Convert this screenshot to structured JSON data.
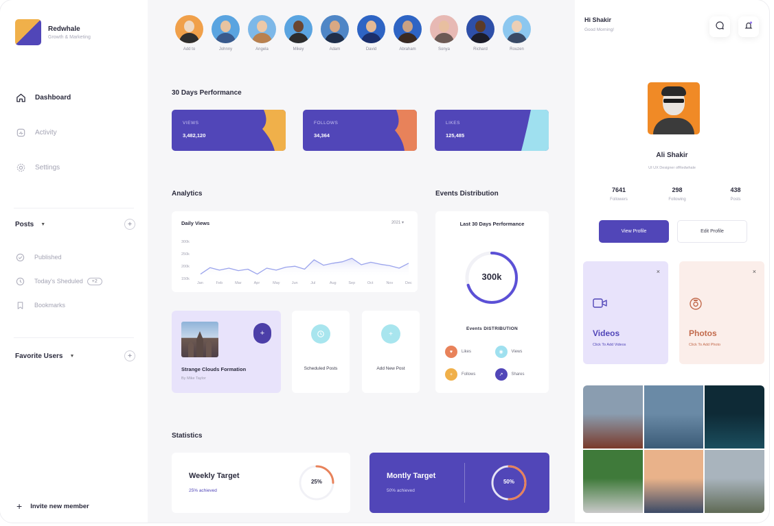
{
  "brand": {
    "name": "Redwhale",
    "subtitle": "Growth & Marketing"
  },
  "sidebar": {
    "nav": [
      {
        "label": "Dashboard",
        "icon": "home-icon",
        "active": true
      },
      {
        "label": "Activity",
        "icon": "activity-icon",
        "active": false
      },
      {
        "label": "Settings",
        "icon": "settings-icon",
        "active": false
      }
    ],
    "posts": {
      "title": "Posts",
      "items": [
        {
          "label": "Published",
          "icon": "check-circle-icon"
        },
        {
          "label": "Today's Sheduled",
          "icon": "clock-icon",
          "badge": "+2"
        },
        {
          "label": "Bookmarks",
          "icon": "bookmark-icon"
        }
      ]
    },
    "favorites": {
      "title": "Favorite Users"
    },
    "invite": "Invite new member"
  },
  "avatars": [
    {
      "name": "Add to",
      "bg": "#f0a04a",
      "skin": "#eed9c4",
      "shirt": "#2e2e2e"
    },
    {
      "name": "Johnny",
      "bg": "#5aa4e0",
      "skin": "#e8c3a0",
      "shirt": "#3a5a8c"
    },
    {
      "name": "Angela",
      "bg": "#7db8e8",
      "skin": "#edc9a8",
      "shirt": "#b9814f"
    },
    {
      "name": "Mikey",
      "bg": "#5aa4e0",
      "skin": "#6b4630",
      "shirt": "#2d2d2d"
    },
    {
      "name": "Adam",
      "bg": "#4f86c6",
      "skin": "#d9a883",
      "shirt": "#1f2f4a"
    },
    {
      "name": "David",
      "bg": "#2e64c4",
      "skin": "#e4b995",
      "shirt": "#1b2f6b"
    },
    {
      "name": "Abraham",
      "bg": "#2e64c4",
      "skin": "#caa183",
      "shirt": "#3a2a22"
    },
    {
      "name": "Sonya",
      "bg": "#e7b9b4",
      "skin": "#e8bfa0",
      "shirt": "#6c5a55"
    },
    {
      "name": "Richard",
      "bg": "#2e4fa8",
      "skin": "#5c3b28",
      "shirt": "#1c1c28"
    },
    {
      "name": "Rouzen",
      "bg": "#8cc7ef",
      "skin": "#edcfb5",
      "shirt": "#3a4a66"
    }
  ],
  "performance": {
    "title": "30 Days Performance",
    "cards": [
      {
        "label": "VIEWS",
        "value": "3,482,120",
        "accent": "#f0b04a"
      },
      {
        "label": "FOLLOWS",
        "value": "34,364",
        "accent": "#e8825a"
      },
      {
        "label": "LIKES",
        "value": "125,485",
        "accent": "#9fe0ef"
      }
    ]
  },
  "analytics": {
    "title": "Analytics",
    "chart_title": "Daily Views",
    "year": "2021"
  },
  "chart_data": {
    "type": "line",
    "title": "Daily Views",
    "categories": [
      "Jan",
      "Feb",
      "Mar",
      "Apr",
      "May",
      "Jun",
      "Jul",
      "Aug",
      "Sep",
      "Oct",
      "Nov",
      "Dec"
    ],
    "x_domain": [
      0,
      11
    ],
    "y_ticks": [
      "300k",
      "250k",
      "200k",
      "150k"
    ],
    "ylim": [
      150,
      300
    ],
    "series": [
      {
        "values": [
          [
            0,
            162
          ],
          [
            0.5,
            188
          ],
          [
            1,
            178
          ],
          [
            1.5,
            186
          ],
          [
            2,
            176
          ],
          [
            2.5,
            182
          ],
          [
            3,
            162
          ],
          [
            3.5,
            186
          ],
          [
            4,
            178
          ],
          [
            4.5,
            190
          ],
          [
            5,
            194
          ],
          [
            5.5,
            182
          ],
          [
            6,
            220
          ],
          [
            6.5,
            198
          ],
          [
            7,
            206
          ],
          [
            7.5,
            212
          ],
          [
            8,
            226
          ],
          [
            8.5,
            200
          ],
          [
            9,
            210
          ],
          [
            9.5,
            202
          ],
          [
            10,
            196
          ],
          [
            10.5,
            186
          ],
          [
            11,
            206
          ]
        ]
      }
    ],
    "grid": false,
    "color": "#9aa3ec"
  },
  "events": {
    "title": "Events Distribution",
    "card_title": "Last 30 Days Performance",
    "total": "300k",
    "ring_fraction": 0.7,
    "subtitle": "Events DISTRIBUTION",
    "legend": [
      {
        "label": "Likes",
        "color": "#e8825a"
      },
      {
        "label": "Views",
        "color": "#9fe0ef"
      },
      {
        "label": "Follows",
        "color": "#f0b04a"
      },
      {
        "label": "Shares",
        "color": "#5146b8"
      }
    ]
  },
  "post_card": {
    "title": "Strange Clouds Formation",
    "author": "By Mike Taylor"
  },
  "scheduled": {
    "label": "Scheduled Posts"
  },
  "add_post": {
    "label": "Add New Post"
  },
  "statistics": {
    "title": "Statistics",
    "weekly": {
      "title": "Weekly Target",
      "sub": "25% achieved",
      "value": "25%",
      "fraction": 0.25
    },
    "monthly": {
      "title": "Montly Target",
      "sub": "50% achieved",
      "value": "50%",
      "fraction": 0.5
    }
  },
  "profile": {
    "greeting": "Hi Shakir",
    "greeting_sub": "Good Morning!",
    "name": "Ali Shakir",
    "role": "UI UX Designer ofRedwhale",
    "stats": [
      {
        "value": "7641",
        "label": "Followers"
      },
      {
        "value": "298",
        "label": "Following"
      },
      {
        "value": "438",
        "label": "Posts"
      }
    ],
    "view_label": "View Profile",
    "edit_label": "Edit Profile"
  },
  "media": {
    "videos": {
      "title": "Videos",
      "sub": "Click To Add Videos"
    },
    "photos": {
      "title": "Photos",
      "sub": "Click To Add Photo"
    }
  },
  "gallery": [
    {
      "top": "#8a9db0",
      "bottom": "#7a3a2a"
    },
    {
      "top": "#6a8aa6",
      "bottom": "#3b5b77"
    },
    {
      "top": "#0e2a36",
      "bottom": "#1b4e5e"
    },
    {
      "top": "#3f7a3a",
      "bottom": "#c9c9c9"
    },
    {
      "top": "#e9b28a",
      "bottom": "#3b4a66"
    },
    {
      "top": "#a9b4bd",
      "bottom": "#5f6a55"
    }
  ]
}
